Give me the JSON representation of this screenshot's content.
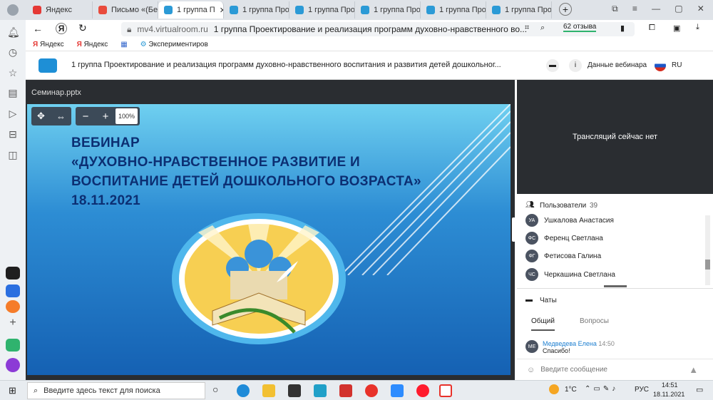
{
  "browser": {
    "tabs": [
      {
        "label": "Яндекс",
        "color": "#e53935"
      },
      {
        "label": "Письмо «(Без",
        "color": "#e94b3c"
      },
      {
        "label": "1 группа П",
        "color": "#2b9ad6"
      },
      {
        "label": "1 группа Про",
        "color": "#2b9ad6"
      },
      {
        "label": "1 группа Про",
        "color": "#2b9ad6"
      },
      {
        "label": "1 группа Про",
        "color": "#2b9ad6"
      },
      {
        "label": "1 группа Про",
        "color": "#2b9ad6"
      },
      {
        "label": "1 группа Про",
        "color": "#2b9ad6"
      }
    ],
    "url_domain": "mv4.virtualroom.ru",
    "page_title": "1 группа Проектирование и реализация программ духовно-нравственного во...",
    "reviews": "62 отзыва",
    "bookmarks": [
      "Яндекс",
      "Яндекс",
      "Экспериментиров"
    ]
  },
  "app": {
    "title": "1 группа Проектирование и реализация программ духовно-нравственного воспитания и развития детей дошкольног...",
    "webinar_data": "Данные вебинара",
    "lang": "RU"
  },
  "presentation": {
    "file": "Семинар.pptx",
    "zoom": "100%",
    "slide_lines": [
      "ВЕБИНАР",
      "«ДУХОВНО-НРАВСТВЕННОЕ РАЗВИТИЕ И",
      "ВОСПИТАНИЕ ДЕТЕЙ ДОШКОЛЬНОГО ВОЗРАСТА»",
      "18.11.2021"
    ]
  },
  "video": {
    "status": "Трансляций сейчас нет"
  },
  "users": {
    "label": "Пользователи",
    "count": "39",
    "list": [
      {
        "initials": "УА",
        "name": "Ушкалова Анастасия"
      },
      {
        "initials": "ФС",
        "name": "Ференц Светлана"
      },
      {
        "initials": "ФГ",
        "name": "Фетисова Галина"
      },
      {
        "initials": "ЧС",
        "name": "Черкашина Светлана"
      }
    ]
  },
  "chats": {
    "label": "Чаты",
    "tab_general": "Общий",
    "tab_questions": "Вопросы",
    "message": {
      "initials": "МЕ",
      "author": "Медведева Елена",
      "time": "14:50",
      "text": "Спасибо!"
    },
    "input_placeholder": "Введите сообщение"
  },
  "taskbar": {
    "search_placeholder": "Введите здесь текст для поиска",
    "weather": "1°C",
    "lang": "РУС",
    "time": "14:51",
    "date": "18.11.2021"
  }
}
